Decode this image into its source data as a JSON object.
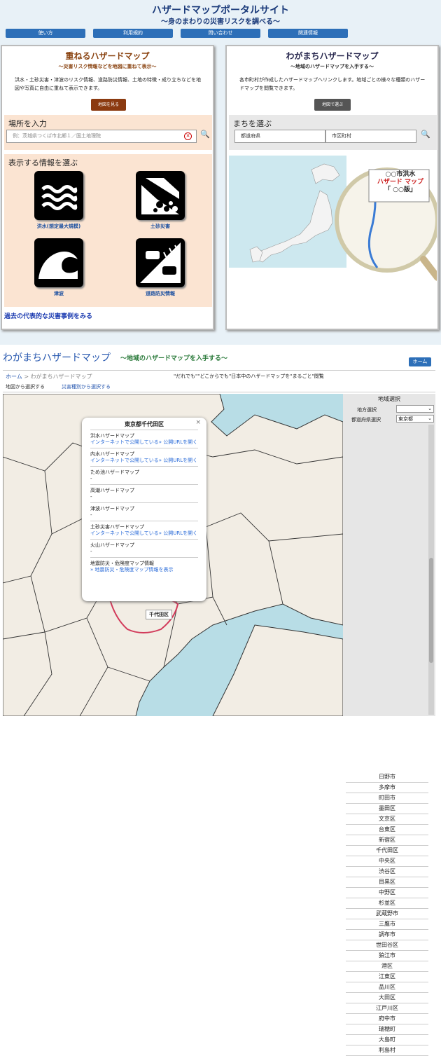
{
  "header": {
    "title": "ハザードマップポータルサイト",
    "subtitle": "〜身のまわりの災害リスクを調べる〜",
    "nav": [
      "使い方",
      "利用規約",
      "問い合わせ",
      "関連情報"
    ]
  },
  "left": {
    "title": "重ねるハザードマップ",
    "tagline": "〜災害リスク情報などを地図に重ねて表示〜",
    "desc": "洪水・土砂災害・津波のリスク情報、道路防災情報、土地の特徴・成り立ちなどを地図や写真に自由に重ねて表示できます。",
    "button": "地図を見る",
    "place_heading": "場所を入力",
    "search_placeholder": "例：茨城県つくば市北郷１／国土地理院",
    "info_heading": "表示する情報を選ぶ",
    "hazards": [
      {
        "label": "洪水(想定最大規模)",
        "icon": "flood-icon"
      },
      {
        "label": "土砂災害",
        "icon": "landslide-icon"
      },
      {
        "label": "津波",
        "icon": "tsunami-icon"
      },
      {
        "label": "道路防災情報",
        "icon": "road-icon"
      }
    ],
    "past_link": "過去の代表的な災害事例をみる"
  },
  "right": {
    "title": "わがまちハザードマップ",
    "tagline": "〜地域のハザードマップを入手する〜",
    "desc": "各市町村が作成したハザードマップへリンクします。地域ごとの様々な種類のハザードマップを閲覧できます。",
    "button": "地図で選ぶ",
    "town_heading": "まちを選ぶ",
    "pref_label": "都道府県",
    "city_label": "市区町村",
    "magnifier": [
      "○○市洪水",
      "ハザード マップ",
      "「 ○○版」"
    ]
  },
  "bottom": {
    "title": "わがまちハザードマップ",
    "subtitle": "〜地域のハザードマップを入手する〜",
    "home_button": "ホーム",
    "breadcrumb": [
      "ホーム",
      "わがまちハザードマップ"
    ],
    "slogan": "\"だれでも\"\"どこからでも\"日本中のハザードマップを\"まるごと\"閲覧",
    "tabs": [
      "地図から選択する",
      "災害種別から選択する"
    ],
    "popup": {
      "title": "東京都千代田区",
      "items": [
        {
          "name": "洪水ハザードマップ",
          "link": "インターネットで公開している» 公開URLを開く"
        },
        {
          "name": "内水ハザードマップ",
          "link": "インターネットで公開している» 公開URLを開く"
        },
        {
          "name": "ため池ハザードマップ",
          "link": "-"
        },
        {
          "name": "高潮ハザードマップ",
          "link": "-"
        },
        {
          "name": "津波ハザードマップ",
          "link": "-"
        },
        {
          "name": "土砂災害ハザードマップ",
          "link": "インターネットで公開している» 公開URLを開く"
        },
        {
          "name": "火山ハザードマップ",
          "link": "-"
        },
        {
          "name": "地震防災・危険度マップ情報",
          "link": "» 地震防災・危険度マップ情報を表示"
        }
      ]
    },
    "map_label": "千代田区",
    "region": {
      "heading": "地域選択",
      "area_label": "地方選択",
      "pref_label": "都道府県選択",
      "pref_value": "東京都",
      "list": [
        "日野市",
        "多摩市",
        "町田市",
        "墨田区",
        "文京区",
        "台東区",
        "新宿区",
        "千代田区",
        "中央区",
        "渋谷区",
        "目黒区",
        "中野区",
        "杉並区",
        "武蔵野市",
        "三鷹市",
        "調布市",
        "世田谷区",
        "狛江市",
        "港区",
        "江東区",
        "品川区",
        "大田区",
        "江戸川区",
        "府中市",
        "瑞穂町",
        "大島町",
        "利島村"
      ]
    }
  },
  "colors": {
    "brand_blue": "#2d6fb8",
    "brown": "#8b4513",
    "map_land": "#f2ede4",
    "map_sea": "#b8dde6",
    "boundary": "#d23a5a"
  }
}
